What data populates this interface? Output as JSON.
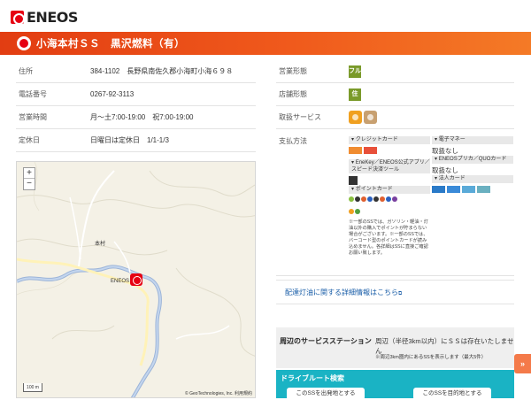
{
  "brand": {
    "logo_text": "ENEOS"
  },
  "banner": {
    "title": "小海本村ＳＳ　黒沢燃料（有）"
  },
  "info": [
    {
      "label": "住所",
      "value": "384-1102　長野県南佐久郡小海町小海６９８"
    },
    {
      "label": "電話番号",
      "value": "0267-92-3113"
    },
    {
      "label": "営業時間",
      "value": "月～土7:00-19:00　祝7:00-19:00"
    },
    {
      "label": "定休日",
      "value": "日曜日は定休日　1/1-1/3"
    }
  ],
  "side": {
    "business_type_label": "営業形態",
    "business_type_tag": "フル",
    "store_type_label": "店舗形態",
    "store_type_tag": "住",
    "services_label": "取扱サービス",
    "payment_label": "支払方法"
  },
  "payment": {
    "credit_head": "クレジットカード",
    "emoney_head": "電子マネー",
    "emoney_value": "取扱なし",
    "enekey_head": "EneKey／ENEOS公式アプリ／スピード決済ツール",
    "prica_head": "ENEOSプリカ／QUOカード",
    "prica_value": "取扱なし",
    "corp_head": "法人カード",
    "point_head": "ポイントカード",
    "note": "※一部のSSでは、ガソリン・軽油・灯油以外の購入でポイントが貯まらない場合がございます。※一部のSSでは、バーコード型のポイントカードが読み込めません。各詳細はSSに直接ご確認お願い致します。"
  },
  "links": {
    "kerosene": "配達灯油に関する詳細情報はこちら"
  },
  "nearby": {
    "title": "周辺のサービスステーション",
    "text": "周辺（半径3km以内）にＳＳは存在いたしません",
    "sub": "※周辺3km圏内にあるSSを表示します（最大5件）"
  },
  "drive": {
    "title": "ドライブルート検索",
    "btn_start": "このSSを出発地とする",
    "btn_goal": "このSSを目的地とする"
  },
  "map": {
    "zoom_in": "+",
    "zoom_out": "−",
    "label_town": "本村",
    "label_pin": "ENEOS",
    "scale": "100 m",
    "copyright": "© GeoTechnologies, Inc.  利用規約"
  },
  "scroll_top": "»",
  "colors": {
    "accent": "#e60012",
    "banner": "#f05a1c",
    "drive": "#1ab3c4"
  }
}
